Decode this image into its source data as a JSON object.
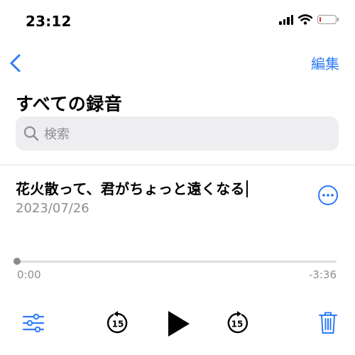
{
  "status_bar": {
    "time": "23:12",
    "battery_level": 0.08,
    "battery_color": "#e0262a"
  },
  "nav": {
    "back_icon": "chevron-left-icon",
    "edit_label": "編集"
  },
  "page": {
    "title": "すべての録音"
  },
  "search": {
    "placeholder": "検索"
  },
  "recording": {
    "title": "花火散って、君がちょっと遠くなる",
    "date": "2023/07/26",
    "elapsed": "0:00",
    "remaining": "-3:36",
    "progress": 0
  },
  "controls": {
    "skip_back_seconds": "15",
    "skip_forward_seconds": "15",
    "icons": [
      "sliders-icon",
      "skip-back-15-icon",
      "play-icon",
      "skip-forward-15-icon",
      "trash-icon"
    ]
  },
  "colors": {
    "accent": "#2f7cf6",
    "secondary_text": "#8e8e93",
    "search_bg": "#eeeef0"
  }
}
